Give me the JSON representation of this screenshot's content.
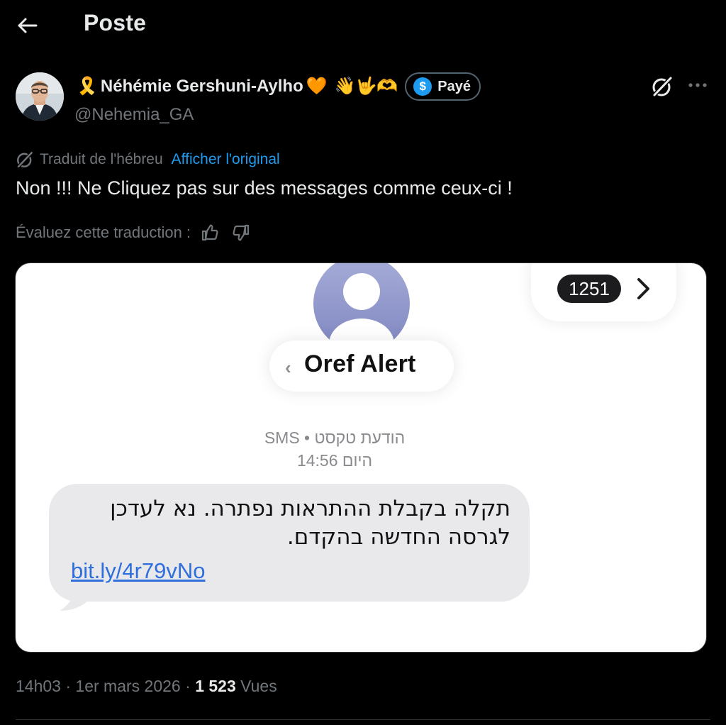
{
  "header": {
    "title": "Poste",
    "back_icon": "arrow-left-icon"
  },
  "author": {
    "name": "Néhémie Gershuni-Aylho",
    "handle": "@Nehemia_GA",
    "ribbon_emoji": "🎗️",
    "heart_emoji": "🧡",
    "trailing_emojis": "👋🤟🫶",
    "paid_badge": {
      "symbol": "$",
      "label": "Payé"
    }
  },
  "translation": {
    "translated_from": "Traduit de l'hébreu",
    "show_original": "Afficher l'original",
    "rate_label": "Évaluez cette traduction :"
  },
  "tweet": {
    "text": "Non !!! Ne Cliquez pas sur des messages comme ceux-ci !"
  },
  "media": {
    "counter": "1251",
    "back_chevron": "‹",
    "contact_name": "Oref Alert",
    "sms_line": "הודעת טקסט • SMS",
    "time_line": "היום 14:56",
    "message_lines": [
      "תקלה בקבלת ההתראות נפתרה. נא לעדכן",
      "לגרסה החדשה בהקדם."
    ],
    "link": "bit.ly/4r79vNo"
  },
  "footer": {
    "time": "14h03",
    "separator": "·",
    "date": "1er mars 2026",
    "views_count": "1 523",
    "views_label": "Vues"
  },
  "colors": {
    "background": "#000000",
    "primary_text": "#e7e9ea",
    "secondary_text": "#71767b",
    "accent": "#1d9bf0",
    "bubble": "#e9e9eb",
    "link": "#2f6fdc"
  }
}
